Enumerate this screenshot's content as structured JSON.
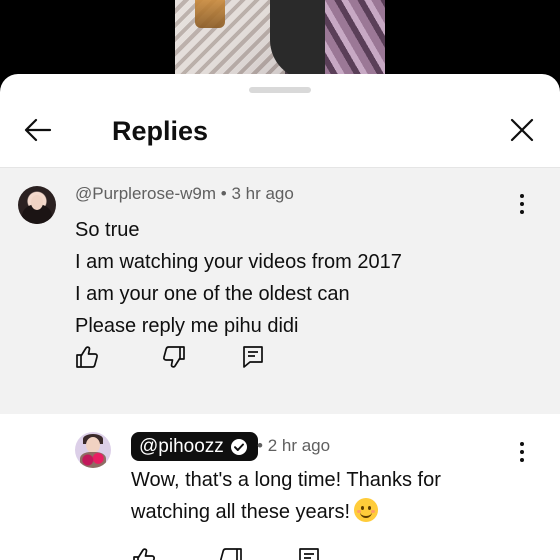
{
  "header": {
    "title": "Replies"
  },
  "comment": {
    "author": "@Purplerose-w9m",
    "time": "3 hr ago",
    "lines": [
      "So true",
      "I am watching your videos from 2017",
      "I am your one of the oldest can",
      "Please reply me pihu didi"
    ]
  },
  "reply": {
    "author": "@pihoozz",
    "time": "2 hr ago",
    "lines": [
      "Wow, that's a long time! Thanks for",
      "watching all these years!"
    ]
  },
  "icons": {
    "back": "arrow-left-icon",
    "close": "close-icon",
    "more": "more-vert-icon",
    "like": "thumbs-up-icon",
    "dislike": "thumbs-down-icon",
    "reply": "comment-reply-icon",
    "verified": "verified-check-icon",
    "emoji": "smiling-face-emoji"
  },
  "colors": {
    "sheet_bg": "#ffffff",
    "parent_bg": "#f2f2f2",
    "badge_bg": "#0f0f0f",
    "meta_text": "#606060"
  }
}
